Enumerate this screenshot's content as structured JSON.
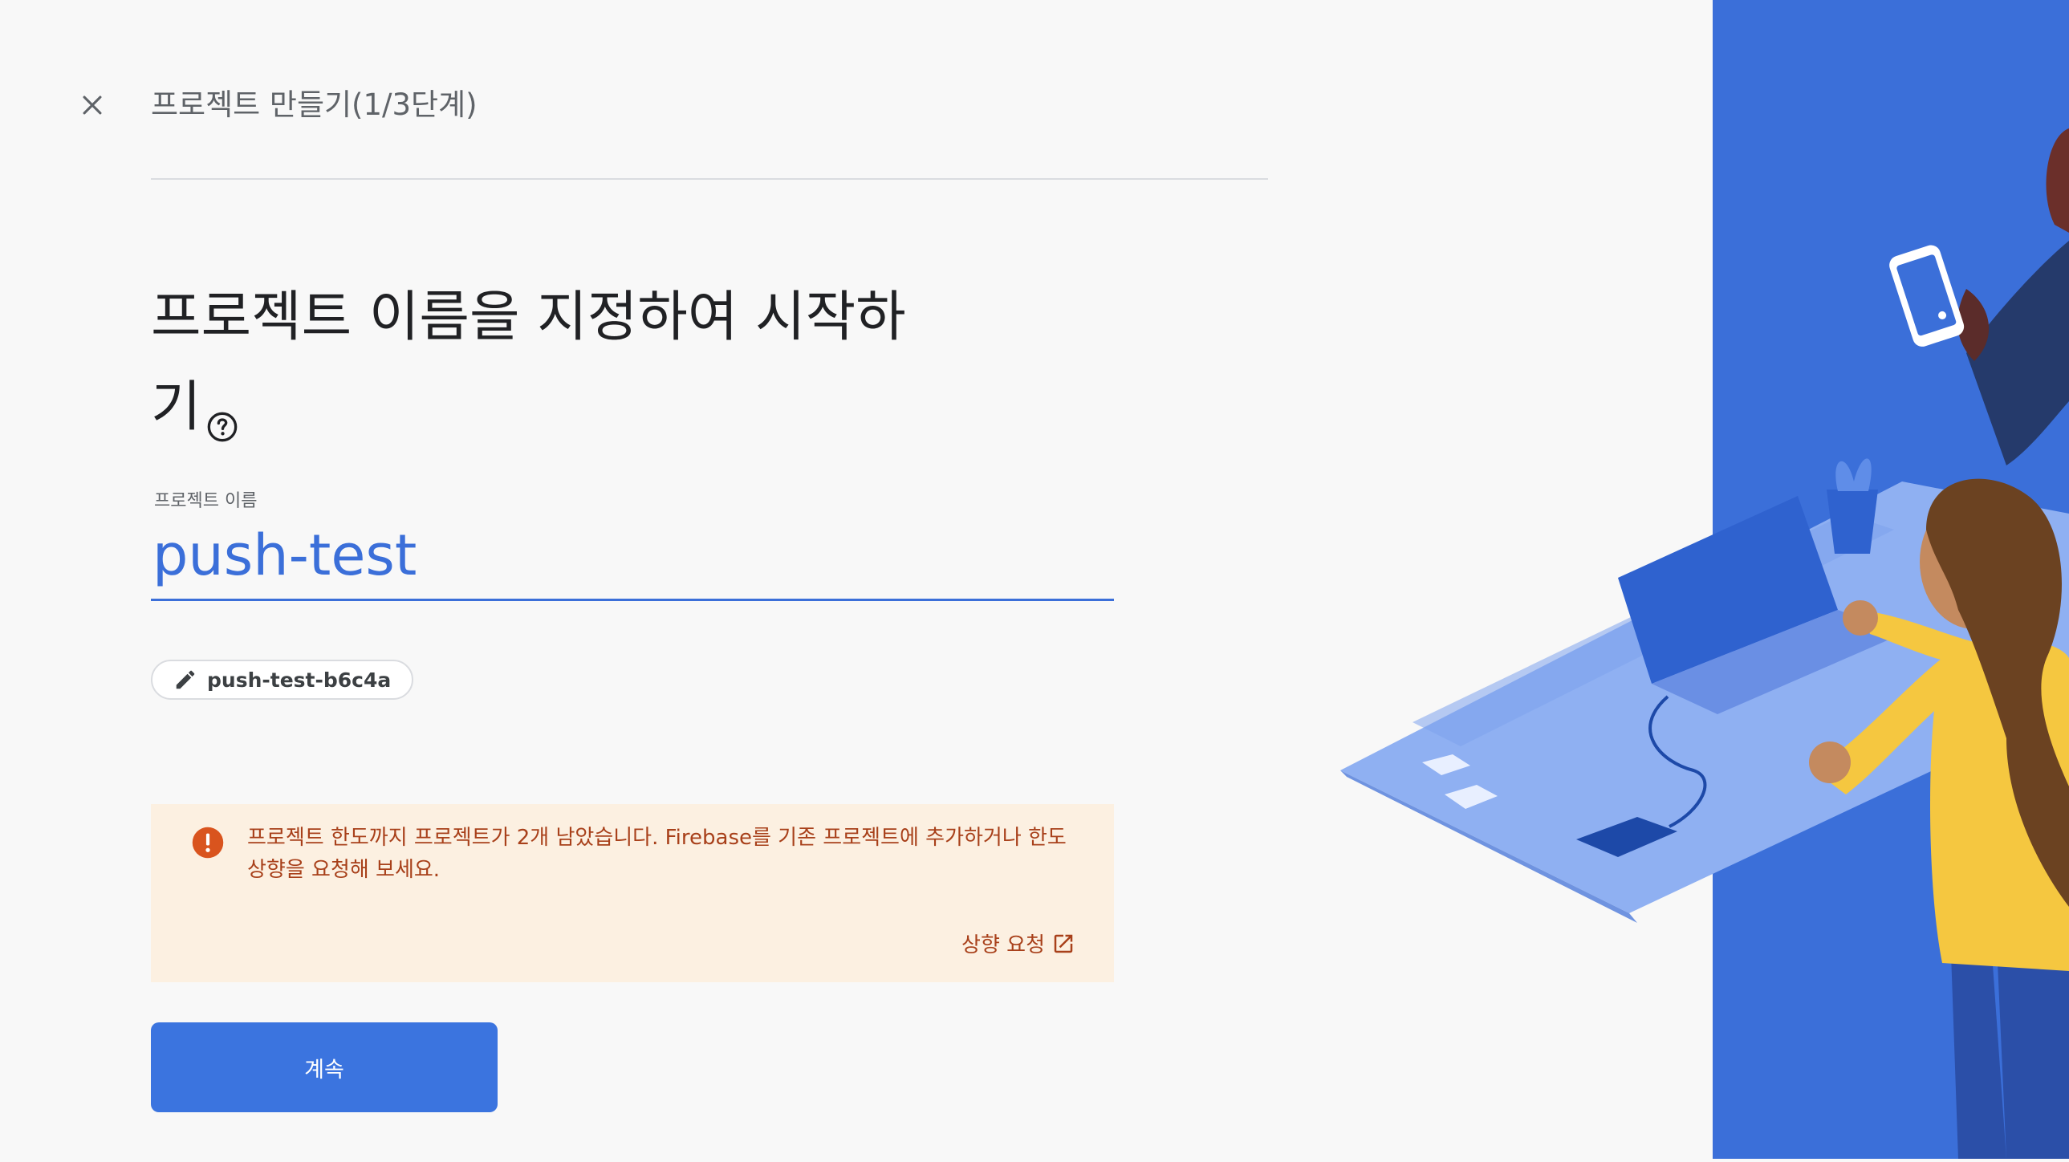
{
  "header": {
    "step_title": "프로젝트 만들기(1/3단계)"
  },
  "heading": {
    "title": "프로젝트 이름을 지정하여 시작하기"
  },
  "project_name": {
    "label": "프로젝트 이름",
    "value": "push-test"
  },
  "project_id": {
    "value": "push-test-b6c4a"
  },
  "warning": {
    "message": "프로젝트 한도까지 프로젝트가 2개 남았습니다. Firebase를 기존 프로젝트에 추가하거나 한도 상향을 요청해 보세요.",
    "link_label": "상향 요청"
  },
  "actions": {
    "continue_label": "계속"
  },
  "colors": {
    "primary": "#3b74df",
    "warning_bg": "#fcf0e1",
    "warning_text": "#a8401a",
    "illustration_bg": "#3b6fd9"
  },
  "icons": [
    "close-icon",
    "help-icon",
    "pencil-icon",
    "error-icon",
    "open-in-new-icon"
  ]
}
